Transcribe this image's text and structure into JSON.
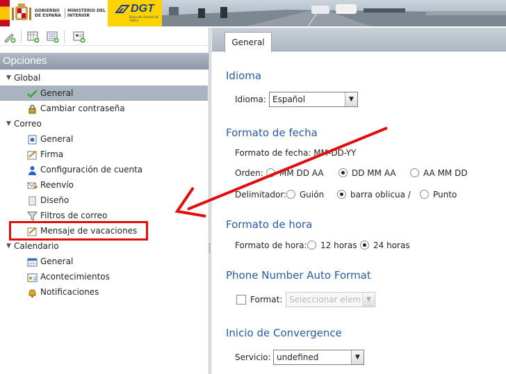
{
  "banner": {
    "gob_text": "GOBIERNO DE ESPAÑA",
    "ministry_text": "MINISTERIO DEL INTERIOR",
    "dgt_logo": "DGT",
    "dgt_sub": "Dirección General de Tráfico"
  },
  "left": {
    "header": "Opciones",
    "tree": [
      {
        "type": "group",
        "label": "Global"
      },
      {
        "type": "item",
        "label": "General",
        "icon": "check-icon",
        "selected": true
      },
      {
        "type": "item",
        "label": "Cambiar contraseña",
        "icon": "lock-icon"
      },
      {
        "type": "group",
        "label": "Correo"
      },
      {
        "type": "item",
        "label": "General",
        "icon": "settings-doc-icon"
      },
      {
        "type": "item",
        "label": "Firma",
        "icon": "signature-icon"
      },
      {
        "type": "item",
        "label": "Configuración de cuenta",
        "icon": "user-icon"
      },
      {
        "type": "item",
        "label": "Reenvío",
        "icon": "forward-mail-icon"
      },
      {
        "type": "item",
        "label": "Diseño",
        "icon": "page-icon"
      },
      {
        "type": "item",
        "label": "Filtros de correo",
        "icon": "filter-icon"
      },
      {
        "type": "item",
        "label": "Mensaje de vacaciones",
        "icon": "vacation-icon",
        "highlighted": true
      },
      {
        "type": "group",
        "label": "Calendario"
      },
      {
        "type": "item",
        "label": "General",
        "icon": "calendar-icon"
      },
      {
        "type": "item",
        "label": "Acontecimientos",
        "icon": "events-icon"
      },
      {
        "type": "item",
        "label": "Notificaciones",
        "icon": "bell-icon"
      }
    ]
  },
  "tab": {
    "label": "General"
  },
  "idioma": {
    "title": "Idioma",
    "label": "Idioma:",
    "value": "Español"
  },
  "fecha": {
    "title": "Formato de fecha",
    "format_label": "Formato de fecha: MM-DD-YY",
    "orden_label": "Orden:",
    "orden_options": [
      "MM DD AA",
      "DD MM AA",
      "AA MM DD"
    ],
    "orden_selected": "DD MM AA",
    "delim_label": "Delimitador:",
    "delim_options": [
      "Guión",
      "barra oblicua /",
      "Punto"
    ],
    "delim_selected": "barra oblicua /"
  },
  "hora": {
    "title": "Formato de hora",
    "label": "Formato de hora:",
    "options": [
      "12 horas",
      "24 horas"
    ],
    "selected": "24 horas"
  },
  "phone": {
    "title": "Phone Number Auto Format",
    "format_label": "Format:",
    "placeholder": "Seleccionar elem"
  },
  "convergence": {
    "title": "Inicio de Convergence",
    "servicio_label": "Servicio:",
    "servicio_value": "undefined"
  },
  "colors": {
    "section_title": "#2a5b9f",
    "selected_row": "#a8b4c0",
    "highlight": "#e10d0d",
    "dgt_yellow": "#ffd200"
  }
}
